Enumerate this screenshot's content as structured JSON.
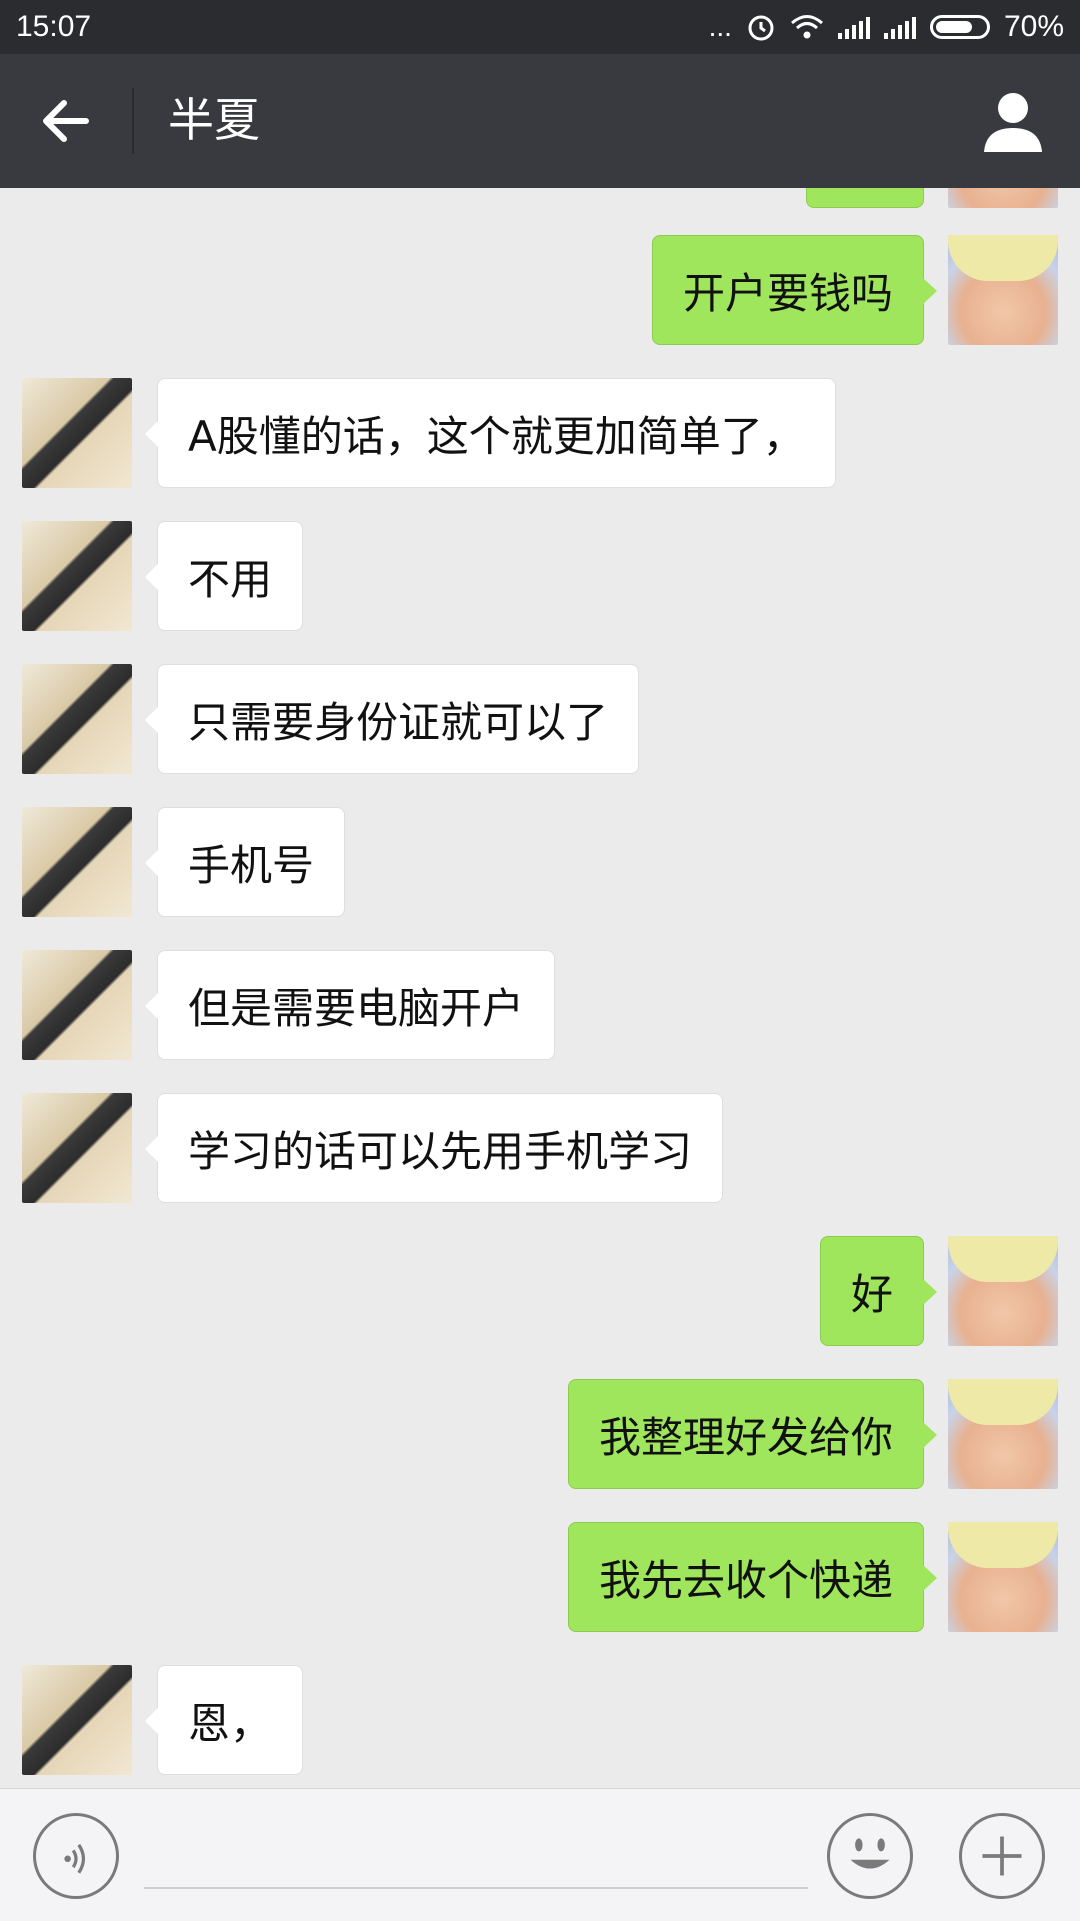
{
  "status_bar": {
    "time": "15:07",
    "more": "...",
    "alarm_icon": "alarm-icon",
    "wifi_icon": "wifi-icon",
    "battery": "70%"
  },
  "title_bar": {
    "title": "半夏",
    "back_icon": "back-arrow-icon",
    "profile_icon": "person-icon"
  },
  "messages": [
    {
      "side": "out",
      "text": "开户要钱吗"
    },
    {
      "side": "in",
      "text": "A股懂的话，这个就更加简单了，"
    },
    {
      "side": "in",
      "text": "不用"
    },
    {
      "side": "in",
      "text": "只需要身份证就可以了"
    },
    {
      "side": "in",
      "text": "手机号"
    },
    {
      "side": "in",
      "text": "但是需要电脑开户"
    },
    {
      "side": "in",
      "text": "学习的话可以先用手机学习"
    },
    {
      "side": "out",
      "text": "好"
    },
    {
      "side": "out",
      "text": "我整理好发给你"
    },
    {
      "side": "out",
      "text": "我先去收个快递"
    },
    {
      "side": "in",
      "text": "恩，"
    }
  ],
  "input_bar": {
    "voice_icon": "voice-icon",
    "emoji_icon": "emoji-icon",
    "plus_icon": "plus-icon",
    "input_value": ""
  },
  "colors": {
    "status_bar_bg": "#2b2c30",
    "title_bar_bg": "#393a3f",
    "chat_bg": "#ebebeb",
    "outgoing_bubble": "#9fe65d",
    "incoming_bubble": "#ffffff"
  }
}
